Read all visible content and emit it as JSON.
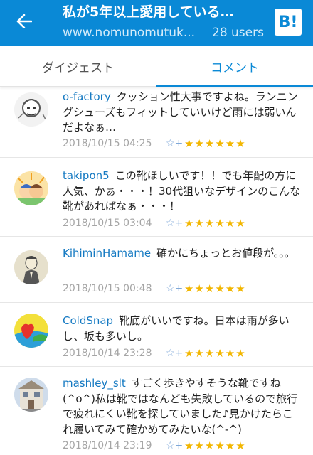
{
  "header": {
    "title": "私が5年以上愛用している…",
    "url": "www.nomunomutuk...",
    "users": "28 users",
    "bookmark_label": "B!"
  },
  "tabs": [
    {
      "label": "ダイジェスト",
      "active": false
    },
    {
      "label": "コメント",
      "active": true
    }
  ],
  "comments": [
    {
      "user": "o-factory",
      "text": "クッション性大事ですよね。ランニングシューズもフィットしていいけど雨には弱いんだよなぁ…",
      "date": "2018/10/15 04:25",
      "stars": "★★★★★★"
    },
    {
      "user": "takipon5",
      "text": "この靴ほしいです！！でも年配の方に人気、かぁ・・・！30代狙いなデザインのこんな靴があればなぁ・・・！",
      "date": "2018/10/15 03:04",
      "stars": "★★★★★★"
    },
    {
      "user": "KihiminHamame",
      "text": "確かにちょっとお値段が。。。",
      "date": "2018/10/15 00:48",
      "stars": "★★★★★★"
    },
    {
      "user": "ColdSnap",
      "text": "靴底がいいですね。日本は雨が多いし、坂も多いし。",
      "date": "2018/10/14 23:28",
      "stars": "★★★★★★"
    },
    {
      "user": "mashley_slt",
      "text": "すごく歩きやすそうな靴ですね(^o^)私は靴ではなんども失敗しているので旅行で疲れにくい靴を探していました♪見かけたらこれ履いてみて確かめてみたいな(^-^)",
      "date": "2018/10/14 23:19",
      "stars": "★★★★★★"
    }
  ],
  "add_star_icon": "☆+",
  "colors": {
    "accent": "#0a89d6",
    "star": "#f2b600",
    "username": "#1479c2"
  }
}
